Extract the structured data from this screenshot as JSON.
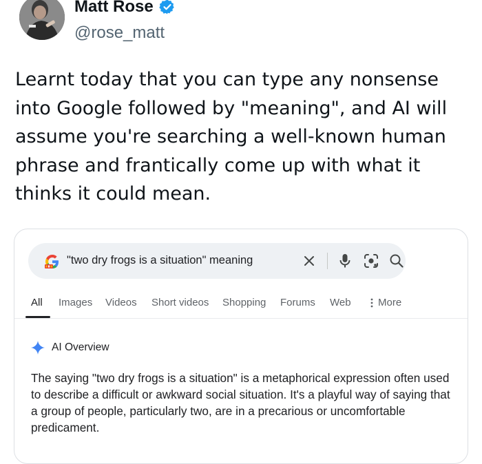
{
  "tweet": {
    "author_name": "Matt Rose",
    "handle": "@rose_matt",
    "text": "Learnt today that you can type any nonsense into Google followed by \"meaning\", and AI will assume you're searching a well-known human phrase and frantically come up with what it thinks it could mean."
  },
  "icons": {
    "verified": "verified-badge-icon",
    "google_logo": "google-g-icon",
    "clear": "close-icon",
    "mic": "microphone-icon",
    "lens": "camera-lens-icon",
    "search": "search-icon",
    "sparkle": "sparkle-icon",
    "more": "vertical-dots-icon"
  },
  "search": {
    "query": "\"two dry frogs is a situation\" meaning"
  },
  "tabs": [
    {
      "label": "All",
      "active": true
    },
    {
      "label": "Images",
      "active": false
    },
    {
      "label": "Videos",
      "active": false
    },
    {
      "label": "Short videos",
      "active": false
    },
    {
      "label": "Shopping",
      "active": false
    },
    {
      "label": "Forums",
      "active": false
    },
    {
      "label": "Web",
      "active": false
    },
    {
      "label": "More",
      "active": false
    }
  ],
  "ai_overview": {
    "title": "AI Overview",
    "body": "The saying \"two dry frogs is a situation\" is a metaphorical expression often used to describe a difficult or awkward social situation. It's a playful way of saying that a group of people, particularly two, are in a precarious or uncomfortable predicament."
  },
  "colors": {
    "verified_blue": "#1d9bf0",
    "handle_gray": "#536471",
    "sparkle_blue": "#4285f4",
    "search_bar_bg": "#eef1f4"
  }
}
